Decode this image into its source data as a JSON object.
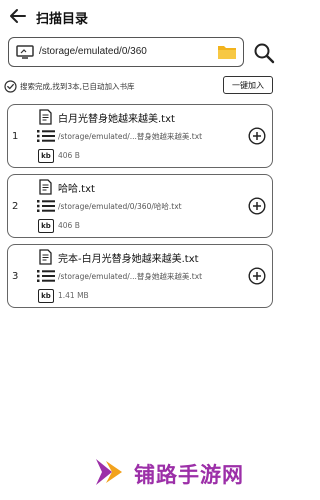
{
  "header": {
    "title": "扫描目录"
  },
  "path_bar": {
    "path": "/storage/emulated/0/360"
  },
  "status": {
    "message": "搜索完成,找到3本,已自动加入书库",
    "add_all_label": "一键加入"
  },
  "files": [
    {
      "index": "1",
      "name": "白月光替身她越来越美.txt",
      "path": "/storage/emulated/...替身她越来越美.txt",
      "size": "406 B"
    },
    {
      "index": "2",
      "name": "哈哈.txt",
      "path": "/storage/emulated/0/360/哈哈.txt",
      "size": "406 B"
    },
    {
      "index": "3",
      "name": "完本-白月光替身她越来越美.txt",
      "path": "/storage/emulated/...替身她越来越美.txt",
      "size": "1.41 MB"
    }
  ],
  "kb_label": "kb",
  "watermark": {
    "text": "铺路手游网"
  },
  "colors": {
    "folder": "#f2b31c",
    "watermark": "#9c2fa8",
    "watermark_accent": "#f2a21c"
  }
}
